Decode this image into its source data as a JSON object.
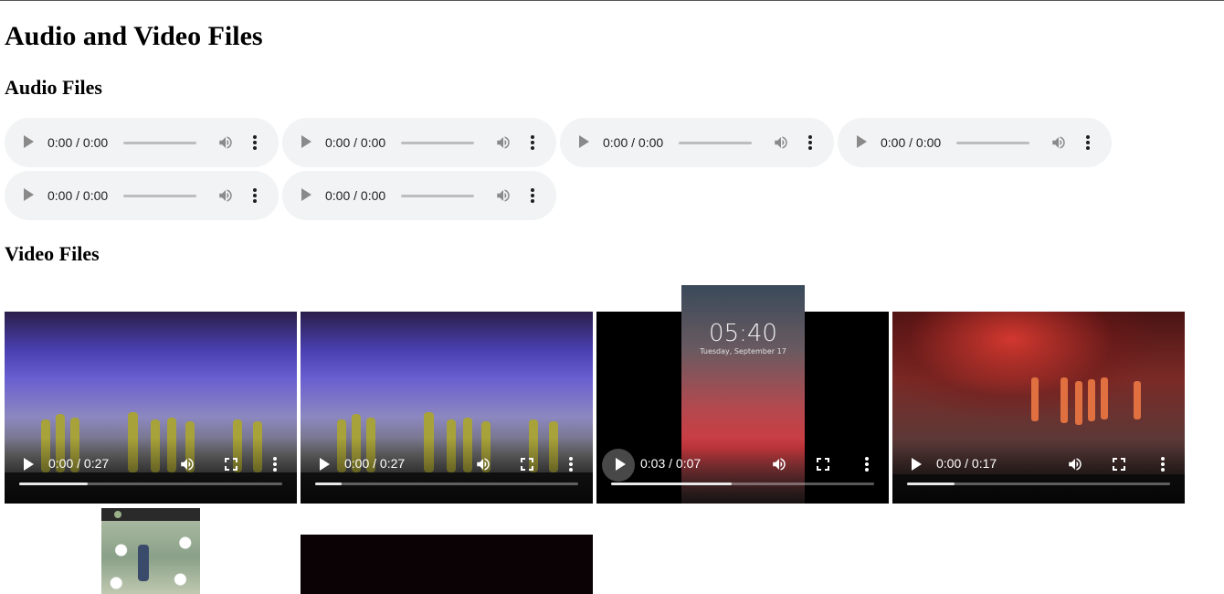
{
  "page": {
    "title": "Audio and Video Files",
    "audio_heading": "Audio Files",
    "video_heading": "Video Files"
  },
  "audio_players": [
    {
      "time": "0:00 / 0:00"
    },
    {
      "time": "0:00 / 0:00"
    },
    {
      "time": "0:00 / 0:00"
    },
    {
      "time": "0:00 / 0:00"
    },
    {
      "time": "0:00 / 0:00"
    },
    {
      "time": "0:00 / 0:00"
    }
  ],
  "video_players": [
    {
      "time": "0:00 / 0:27",
      "progress": 0.26,
      "thumbnail": "dance-performance-blue-stage"
    },
    {
      "time": "0:00 / 0:27",
      "progress": 0.1,
      "thumbnail": "dance-performance-blue-stage"
    },
    {
      "time": "0:03 / 0:07",
      "progress": 0.46,
      "thumbnail": "child-phone-lockscreen"
    },
    {
      "time": "0:00 / 0:17",
      "progress": 0.18,
      "thumbnail": "dance-performance-red-stage"
    },
    {
      "thumbnail": "phone-status-photo-flowers"
    },
    {
      "thumbnail": "dark-video"
    }
  ],
  "phone_overlay": {
    "clock": "05:40",
    "date": "Tuesday, September 17"
  },
  "colors": {
    "audio_bg": "#f1f3f4",
    "page_bg": "#ffffff"
  }
}
